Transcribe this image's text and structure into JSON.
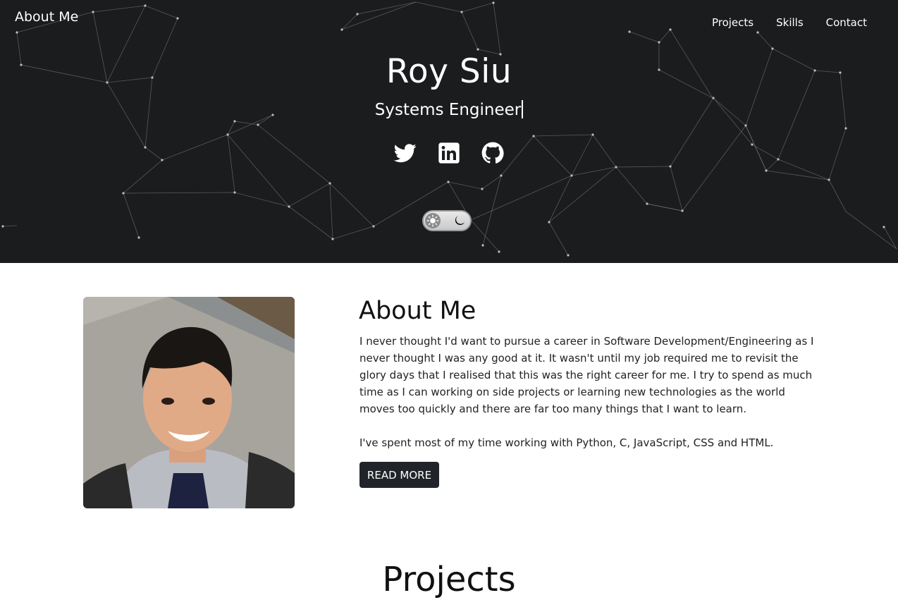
{
  "nav": {
    "brand": "About Me",
    "links": [
      "Projects",
      "Skills",
      "Contact"
    ]
  },
  "hero": {
    "name": "Roy Siu",
    "role": "Systems Engineer",
    "socials": [
      "twitter-icon",
      "linkedin-icon",
      "github-icon"
    ],
    "theme_toggle": {
      "state": "light",
      "icons": [
        "sun-icon",
        "moon-icon"
      ]
    }
  },
  "about": {
    "title": "About Me",
    "paragraphs": [
      "I never thought I'd want to pursue a career in Software Development/Engineering as I never thought I was any good at it. It wasn't until my job required me to revisit the glory days that I realised that this was the right career for me. I try to spend as much time as I can working on side projects or learning new technologies as the world moves too quickly and there are far too many things that I want to learn.",
      "I've spent most of my time working with Python, C, JavaScript, CSS and HTML."
    ],
    "button_label": "READ MORE"
  },
  "projects": {
    "title": "Projects"
  },
  "colors": {
    "hero_bg": "#1b1c1e",
    "button_bg": "#212529",
    "text": "#222222"
  }
}
